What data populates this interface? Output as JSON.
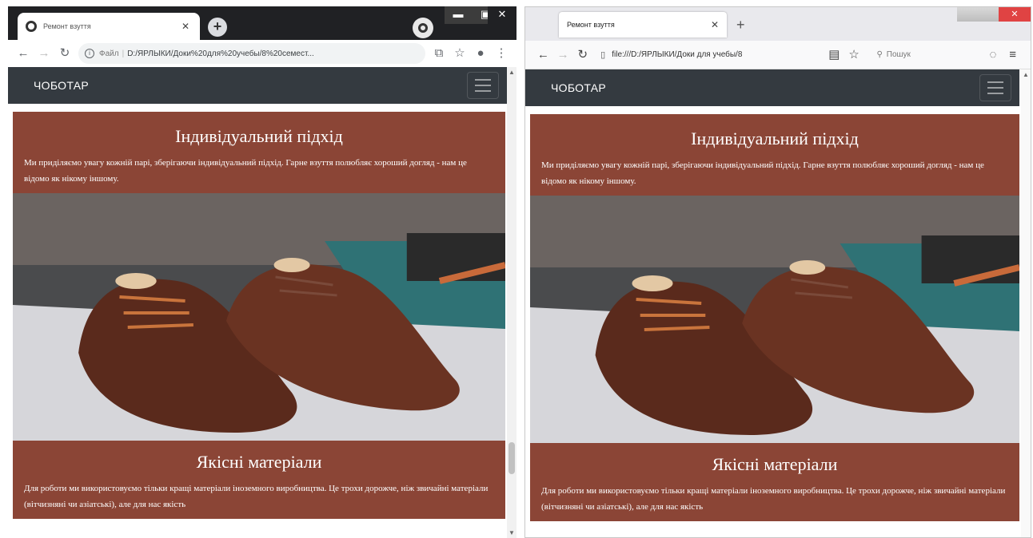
{
  "tab_title": "Ремонт взуття",
  "chrome": {
    "address_label": "Файл",
    "url": "D:/ЯРЛЫКИ/Доки%20для%20учебы/8%20семест...",
    "window_controls": {
      "minimize": "▬",
      "maximize": "▣",
      "close": "✕"
    }
  },
  "firefox": {
    "url": "file:///D:/ЯРЛЫКИ/Доки для учебы/8",
    "search_placeholder": "Пошук",
    "window_close": "✕"
  },
  "page": {
    "brand": "ЧОБОТАР",
    "sections": [
      {
        "heading": "Індивідуальний підхід",
        "text": "Ми приділяємо увагу кожній парі, зберігаючи індивідуальний підхід. Гарне взуття полюбляє хороший догляд - нам це відомо як нікому іншому."
      },
      {
        "heading": "Якісні матеріали",
        "text": "Для роботи ми використовуємо тільки кращі матеріали іноземного виробництва. Це трохи дорожче, ніж звичайні матеріали (вітчизняні чи азіатські), але для нас якість"
      }
    ],
    "colors": {
      "navbar": "#343a40",
      "section_bg": "#8b4536",
      "text": "#ffffff"
    }
  },
  "icons": {
    "back": "back-arrow-icon",
    "forward": "forward-arrow-icon",
    "reload": "reload-icon",
    "menu": "hamburger-menu-icon",
    "star": "star-icon",
    "profile": "profile-icon"
  }
}
